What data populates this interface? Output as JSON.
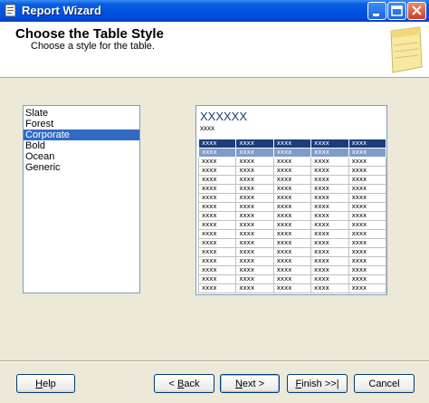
{
  "window": {
    "title": "Report Wizard"
  },
  "header": {
    "title": "Choose the Table Style",
    "subtitle": "Choose a style for the table."
  },
  "style_list": {
    "items": [
      "Slate",
      "Forest",
      "Corporate",
      "Bold",
      "Ocean",
      "Generic"
    ],
    "selected": "Corporate"
  },
  "preview": {
    "title": "XXXXXX",
    "subtitle": "xxxx",
    "cell_text": "xxxx",
    "rows": 17,
    "cols": 5,
    "colors": {
      "header": "#1c3c7a",
      "subheader": "#7f9bc8",
      "title": "#1c3c7a"
    }
  },
  "buttons": {
    "help": {
      "pre": "",
      "key": "H",
      "post": "elp"
    },
    "back": {
      "pre": "< ",
      "key": "B",
      "post": "ack"
    },
    "next": {
      "pre": "",
      "key": "N",
      "post": "ext >"
    },
    "finish": {
      "pre": "",
      "key": "F",
      "post": "inish >>|"
    },
    "cancel": {
      "pre": "Cancel",
      "key": "",
      "post": ""
    }
  },
  "icons": {
    "title_icon": "report-wizard-icon",
    "header_icon": "notepad-icon",
    "minimize": "minimize-icon",
    "maximize": "maximize-icon",
    "close": "close-icon"
  }
}
